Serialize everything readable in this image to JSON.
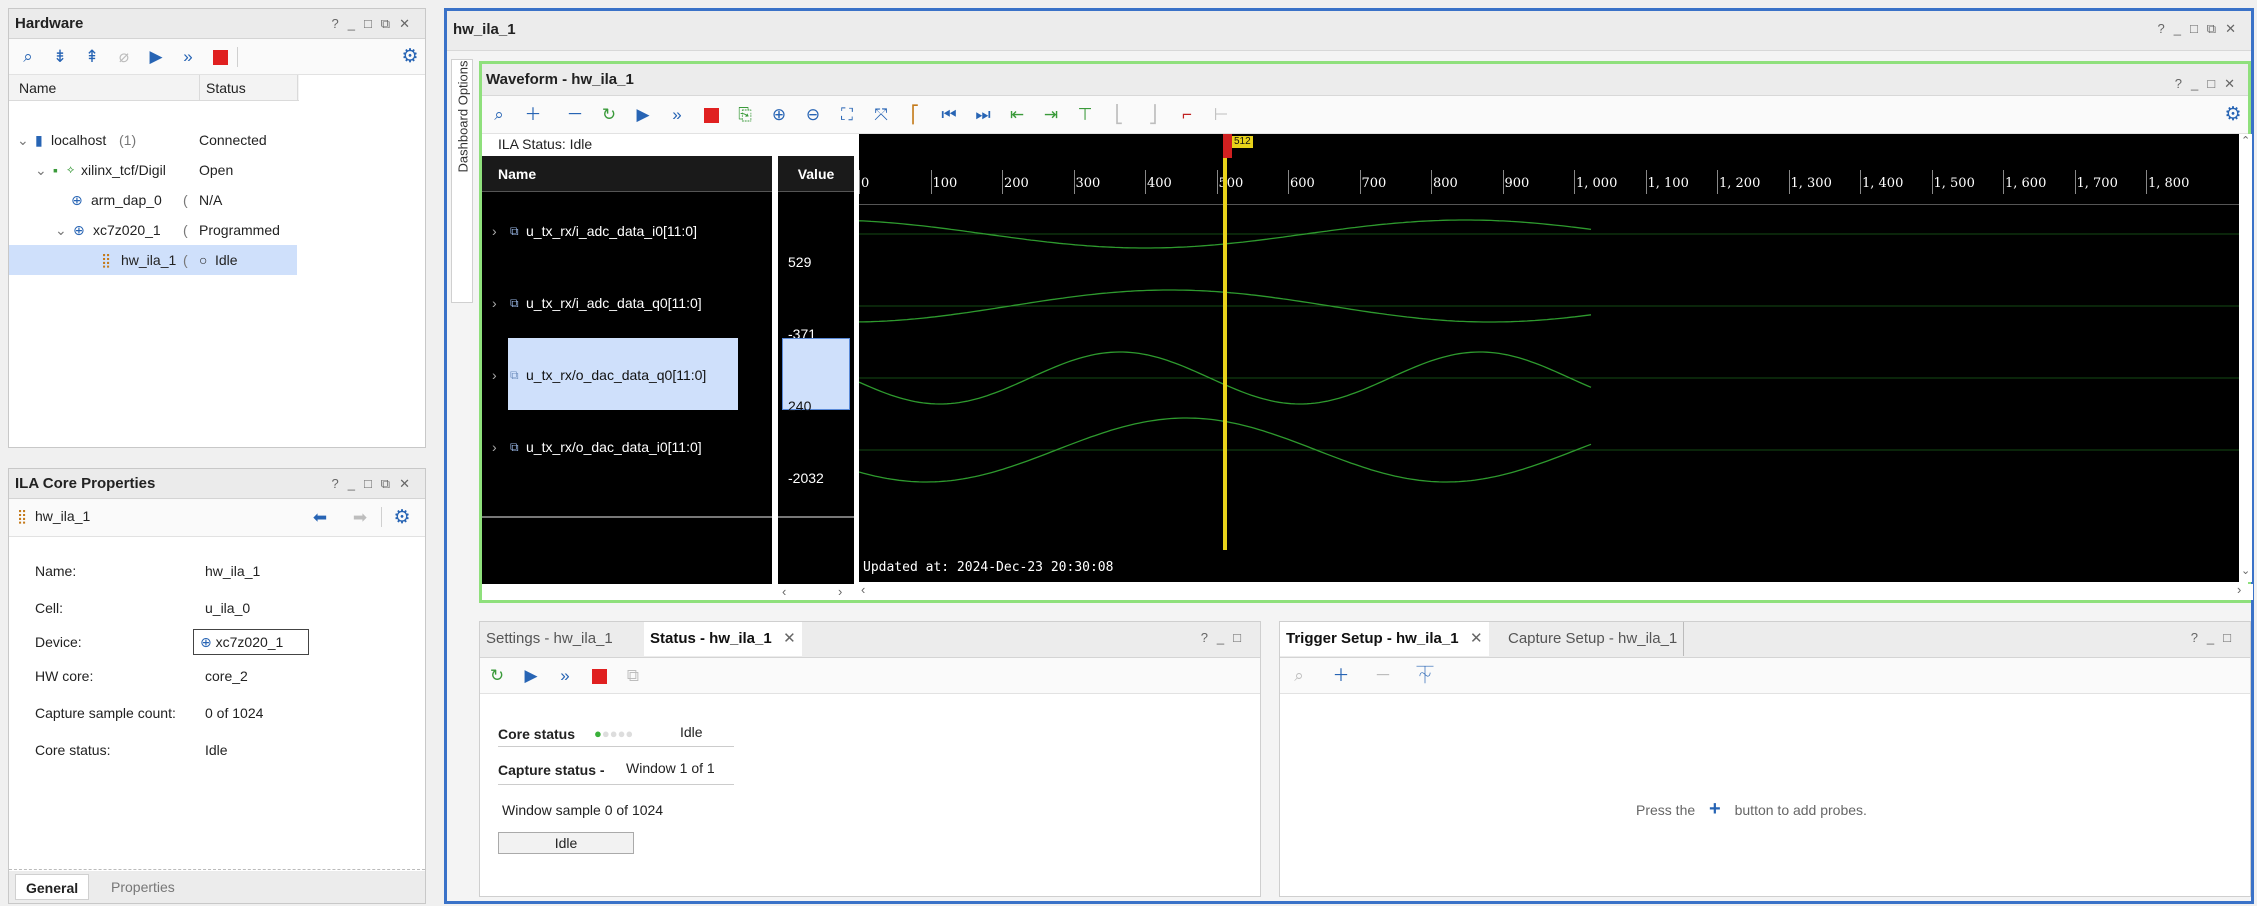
{
  "hardware": {
    "title": "Hardware",
    "columns": [
      "Name",
      "Status"
    ],
    "rows": [
      {
        "name": "localhost",
        "count": "(1)",
        "status": "Connected"
      },
      {
        "name": "xilinx_tcf/Digil",
        "status": "Open"
      },
      {
        "name": "arm_dap_0",
        "suffix": "(",
        "status": "N/A"
      },
      {
        "name": "xc7z020_1",
        "suffix": "(",
        "status": "Programmed"
      },
      {
        "name": "hw_ila_1",
        "suffix": "(",
        "status": "Idle"
      }
    ]
  },
  "ila_props": {
    "title": "ILA Core Properties",
    "object": "hw_ila_1",
    "fields": [
      {
        "label": "Name:",
        "value": "hw_ila_1"
      },
      {
        "label": "Cell:",
        "value": "u_ila_0"
      },
      {
        "label": "Device:",
        "value": "xc7z020_1"
      },
      {
        "label": "HW core:",
        "value": "core_2"
      },
      {
        "label": "Capture sample count:",
        "value": "0 of 1024"
      },
      {
        "label": "Core status:",
        "value": "Idle"
      }
    ],
    "tabs": [
      "General",
      "Properties"
    ]
  },
  "main": {
    "title": "hw_ila_1",
    "dashboard_label": "Dashboard Options",
    "waveform": {
      "title": "Waveform - hw_ila_1",
      "ila_status": "ILA Status:  Idle",
      "col_name": "Name",
      "col_value": "Value",
      "signals": [
        {
          "name": "u_tx_rx/i_adc_data_i0[11:0]",
          "value": "529"
        },
        {
          "name": "u_tx_rx/i_adc_data_q0[11:0]",
          "value": "-371"
        },
        {
          "name": "u_tx_rx/o_dac_data_q0[11:0]",
          "value": "240"
        },
        {
          "name": "u_tx_rx/o_dac_data_i0[11:0]",
          "value": "-2032"
        }
      ],
      "ticks": [
        "0",
        "100",
        "200",
        "300",
        "400",
        "500",
        "600",
        "700",
        "800",
        "900",
        "1, 000",
        "1, 100",
        "1, 200",
        "1, 300",
        "1, 400",
        "1, 500",
        "1, 600",
        "1, 700",
        "1, 800"
      ],
      "cursor_label": "512",
      "updated": "Updated at: 2024-Dec-23 20:30:08"
    }
  },
  "status_panel": {
    "tabs": [
      "Settings - hw_ila_1",
      "Status - hw_ila_1"
    ],
    "core_status_label": "Core status",
    "core_status_value": "Idle",
    "capture_status_label": "Capture status -",
    "capture_status_value": "Window 1 of 1",
    "window_sample": "Window sample 0 of 1024",
    "idle_button": "Idle"
  },
  "trigger_panel": {
    "tabs": [
      "Trigger Setup - hw_ila_1",
      "Capture Setup - hw_ila_1"
    ],
    "hint_before": "Press the",
    "hint_after": "button to add probes."
  },
  "colors": {
    "accent": "#2764b4",
    "selection": "#cfe0fb",
    "wave": "#2e9a2e",
    "cursor": "#e8d21a",
    "stop": "#e02020",
    "frame": "#3a72c8",
    "wave_frame": "#8fe07c"
  }
}
